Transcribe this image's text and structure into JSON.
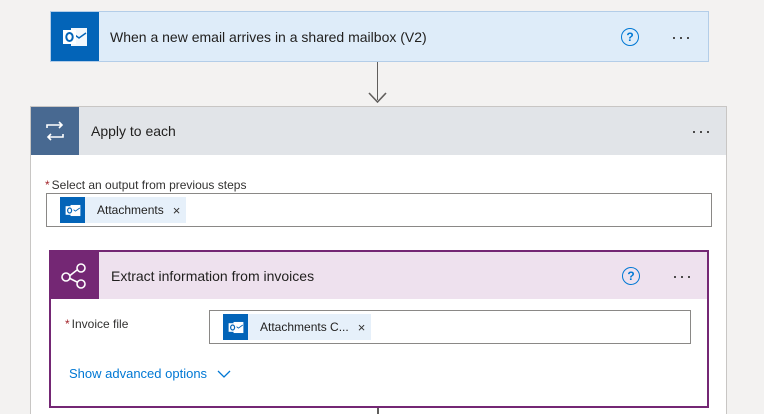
{
  "trigger": {
    "title": "When a new email arrives in a shared mailbox (V2)",
    "help_icon": "question-circle-icon",
    "menu_glyph": "···"
  },
  "apply_each": {
    "title": "Apply to each",
    "menu_glyph": "···",
    "field": {
      "required_mark": "*",
      "label": "Select an output from previous steps",
      "token": {
        "text": "Attachments",
        "remove": "×"
      }
    }
  },
  "extract": {
    "title": "Extract information from invoices",
    "menu_glyph": "···",
    "field": {
      "required_mark": "*",
      "label": "Invoice file",
      "token": {
        "text": "Attachments C...",
        "remove": "×"
      }
    },
    "advanced_link": "Show advanced options"
  },
  "colors": {
    "outlook_blue": "#0364b8",
    "loop_slate": "#486991",
    "ai_purple": "#742774",
    "link_blue": "#0078d4"
  }
}
